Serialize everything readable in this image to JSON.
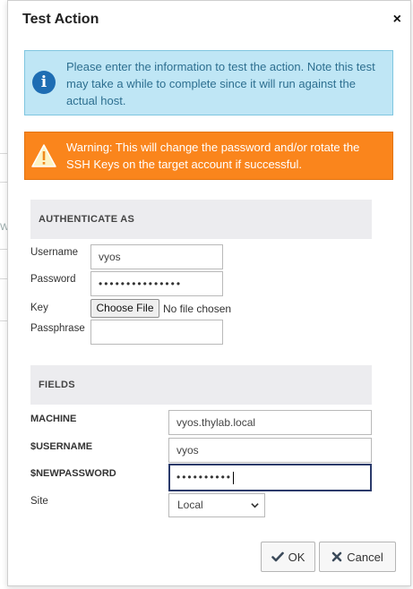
{
  "dialog": {
    "title": "Test Action",
    "close_glyph": "×"
  },
  "alerts": {
    "info_text": "Please enter the information to test the action. Note this test may take a while to complete since it will run against the actual host.",
    "info_icon": "info-icon",
    "warning_text": "Warning: This will change the password and/or rotate the SSH Keys on the target account if successful.",
    "warning_icon": "warning-icon"
  },
  "authenticate": {
    "heading": "AUTHENTICATE AS",
    "username_label": "Username",
    "username_value": "vyos",
    "password_label": "Password",
    "password_mask": "•••••••••••••••",
    "key_label": "Key",
    "choose_file_label": "Choose File",
    "no_file_text": "No file chosen",
    "passphrase_label": "Passphrase",
    "passphrase_value": ""
  },
  "fields": {
    "heading": "FIELDS",
    "machine_label": "MACHINE",
    "machine_value": "vyos.thylab.local",
    "username_label": "$USERNAME",
    "username_value": "vyos",
    "newpassword_label": "$NEWPASSWORD",
    "newpassword_mask": "••••••••••",
    "site_label": "Site",
    "site_selected": "Local"
  },
  "buttons": {
    "ok_label": "OK",
    "cancel_label": "Cancel"
  },
  "background": {
    "partial_letter": "W"
  },
  "colors": {
    "info_bg": "#bfe6f5",
    "info_text": "#2d6f90",
    "warning_bg": "#fa851c",
    "section_bg": "#ececef",
    "focus_border": "#2a3a6b"
  }
}
